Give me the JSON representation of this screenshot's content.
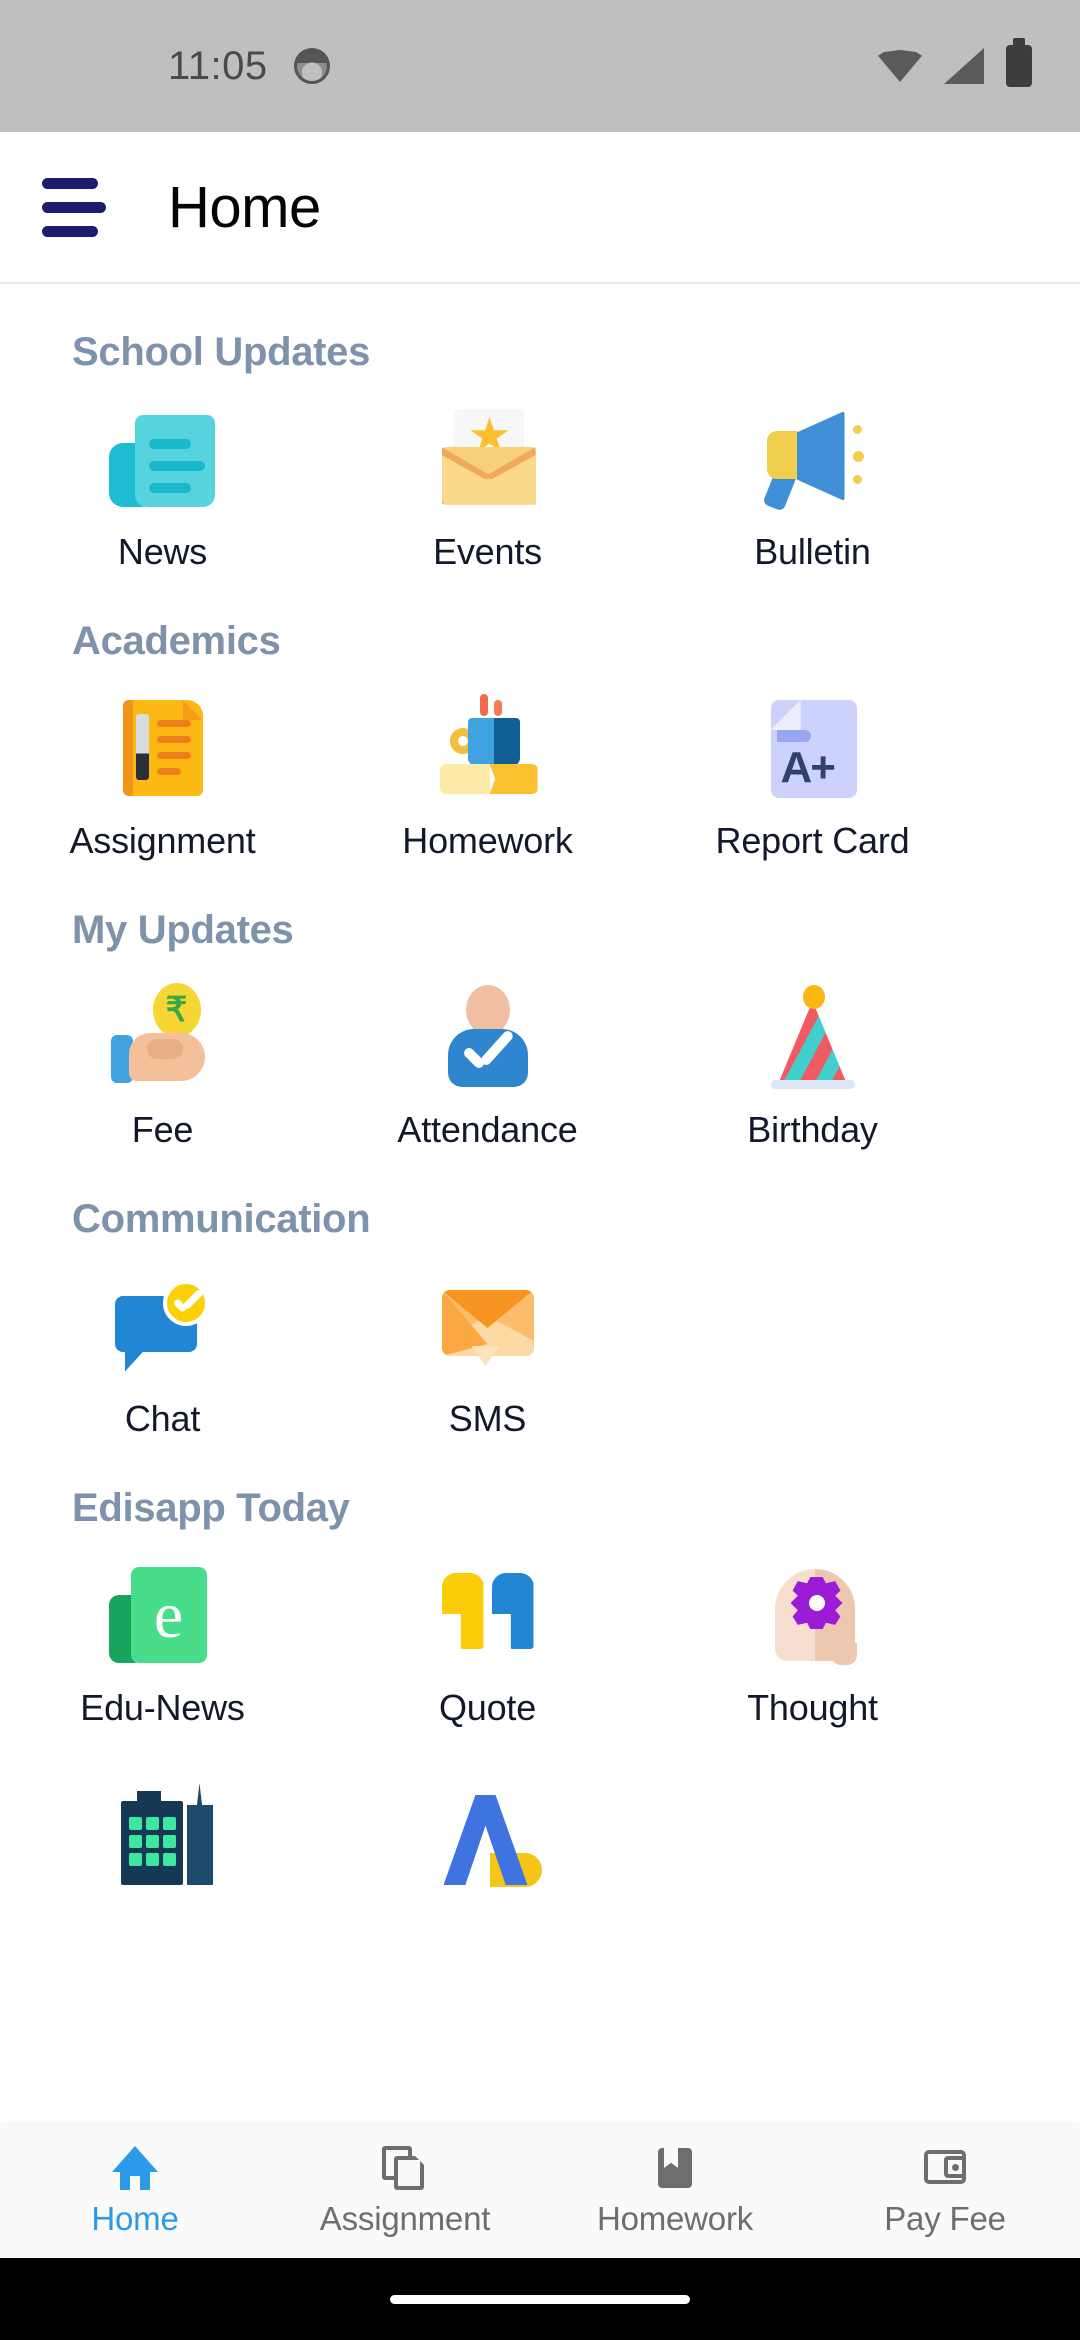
{
  "status_bar": {
    "time": "11:05",
    "notification_icon": "avatar-notification-icon",
    "icons": [
      "wifi-icon",
      "signal-icon",
      "battery-icon"
    ]
  },
  "app_bar": {
    "menu_icon": "hamburger-menu-icon",
    "title": "Home",
    "menu_color": "#1d1d6e"
  },
  "sections": [
    {
      "title": "School Updates",
      "items": [
        {
          "label": "News",
          "icon": "news-document-icon"
        },
        {
          "label": "Events",
          "icon": "envelope-star-icon"
        },
        {
          "label": "Bulletin",
          "icon": "megaphone-icon"
        }
      ]
    },
    {
      "title": "Academics",
      "items": [
        {
          "label": "Assignment",
          "icon": "document-pen-icon"
        },
        {
          "label": "Homework",
          "icon": "cup-books-icon"
        },
        {
          "label": "Report Card",
          "icon": "grade-card-icon",
          "badge_text": "A+"
        }
      ]
    },
    {
      "title": "My Updates",
      "items": [
        {
          "label": "Fee",
          "icon": "hand-rupee-coin-icon",
          "currency_symbol": "₹"
        },
        {
          "label": "Attendance",
          "icon": "person-check-icon"
        },
        {
          "label": "Birthday",
          "icon": "party-hat-icon"
        }
      ]
    },
    {
      "title": "Communication",
      "items": [
        {
          "label": "Chat",
          "icon": "chat-bubble-check-icon"
        },
        {
          "label": "SMS",
          "icon": "orange-envelope-icon"
        }
      ]
    },
    {
      "title": "Edisapp Today",
      "items": [
        {
          "label": "Edu-News",
          "icon": "edu-news-e-icon",
          "badge_text": "e"
        },
        {
          "label": "Quote",
          "icon": "quotation-marks-icon"
        },
        {
          "label": "Thought",
          "icon": "head-gear-icon"
        }
      ]
    }
  ],
  "partial_row": {
    "items": [
      {
        "label": "",
        "icon": "city-buildings-icon"
      },
      {
        "label": "",
        "icon": "blue-a-logo-icon"
      }
    ]
  },
  "bottom_nav": {
    "active": "Home",
    "items": [
      {
        "label": "Home",
        "icon": "home-icon",
        "active": true
      },
      {
        "label": "Assignment",
        "icon": "copy-pages-icon",
        "active": false
      },
      {
        "label": "Homework",
        "icon": "bookmark-icon",
        "active": false
      },
      {
        "label": "Pay Fee",
        "icon": "wallet-icon",
        "active": false
      }
    ]
  },
  "colors": {
    "section_title": "#7e92ab",
    "accent_active": "#2c9ae8",
    "nav_inactive": "#6e6e6e",
    "menu_navy": "#1d1d6e",
    "tile_label": "#14182b"
  }
}
